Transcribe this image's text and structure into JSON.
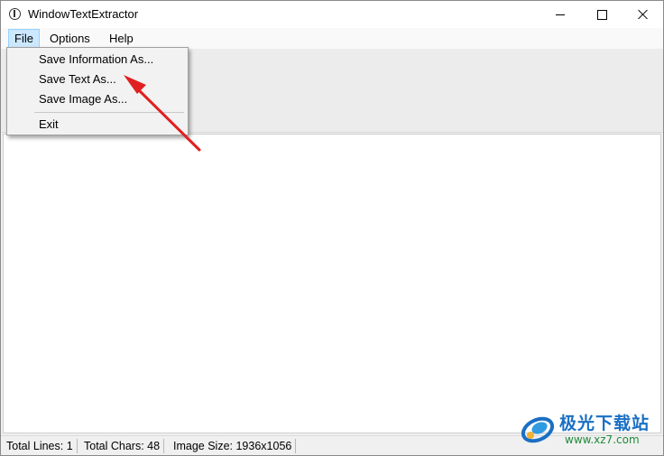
{
  "window": {
    "title": "WindowTextExtractor"
  },
  "menubar": {
    "items": [
      {
        "label": "File"
      },
      {
        "label": "Options"
      },
      {
        "label": "Help"
      }
    ]
  },
  "file_menu": {
    "items": [
      {
        "label": "Save Information As..."
      },
      {
        "label": "Save Text As..."
      },
      {
        "label": "Save Image As..."
      },
      {
        "label": "Exit"
      }
    ]
  },
  "statusbar": {
    "total_lines": "Total Lines: 1",
    "total_chars": "Total Chars: 48",
    "image_size": "Image Size: 1936x1056"
  },
  "annotation": {
    "arrow_color": "#e02020"
  },
  "watermark": {
    "name": "极光下载站",
    "url": "www.xz7.com"
  },
  "colors": {
    "menu_highlight": "#cce8ff",
    "watermark_blue": "#1a6fc4",
    "watermark_green": "#1f8a3a"
  }
}
